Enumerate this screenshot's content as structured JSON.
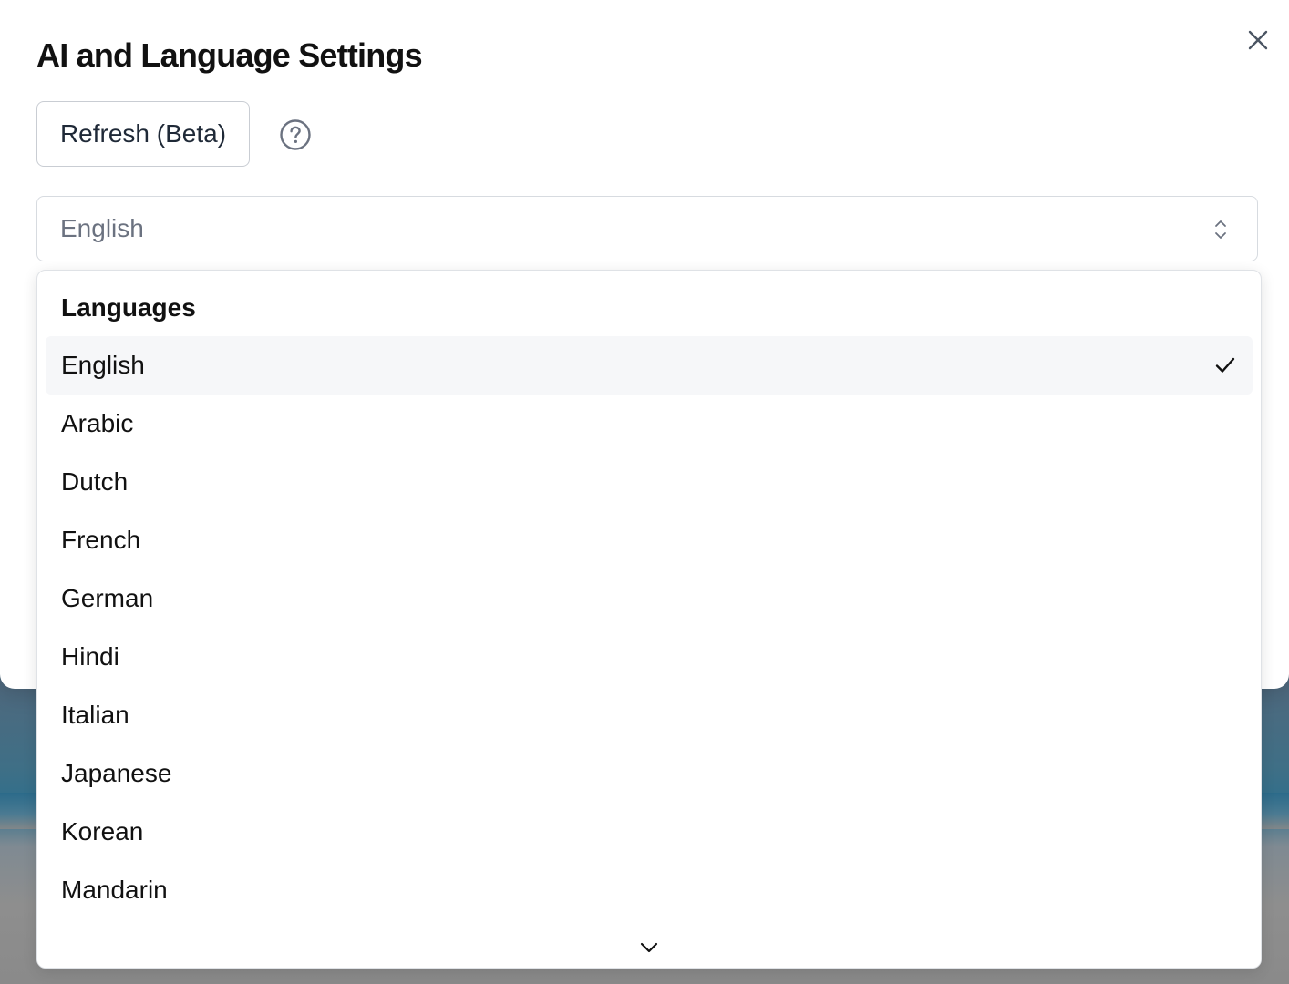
{
  "modal": {
    "title": "AI and Language Settings",
    "refresh_label": "Refresh (Beta)",
    "icons": {
      "close": "close-icon",
      "help": "help-circle-icon"
    }
  },
  "language_select": {
    "value": "English",
    "icon": "chevron-up-down-icon"
  },
  "dropdown": {
    "header": "Languages",
    "options": [
      {
        "label": "English",
        "selected": true
      },
      {
        "label": "Arabic",
        "selected": false
      },
      {
        "label": "Dutch",
        "selected": false
      },
      {
        "label": "French",
        "selected": false
      },
      {
        "label": "German",
        "selected": false
      },
      {
        "label": "Hindi",
        "selected": false
      },
      {
        "label": "Italian",
        "selected": false
      },
      {
        "label": "Japanese",
        "selected": false
      },
      {
        "label": "Korean",
        "selected": false
      },
      {
        "label": "Mandarin",
        "selected": false
      }
    ],
    "selected_icon": "checkmark-icon",
    "scroll_icon": "chevron-down-icon"
  },
  "colors": {
    "title_text": "#111111",
    "muted_text": "#6b7280",
    "border": "#d7dbe0",
    "selected_bg": "#f6f7f9"
  }
}
